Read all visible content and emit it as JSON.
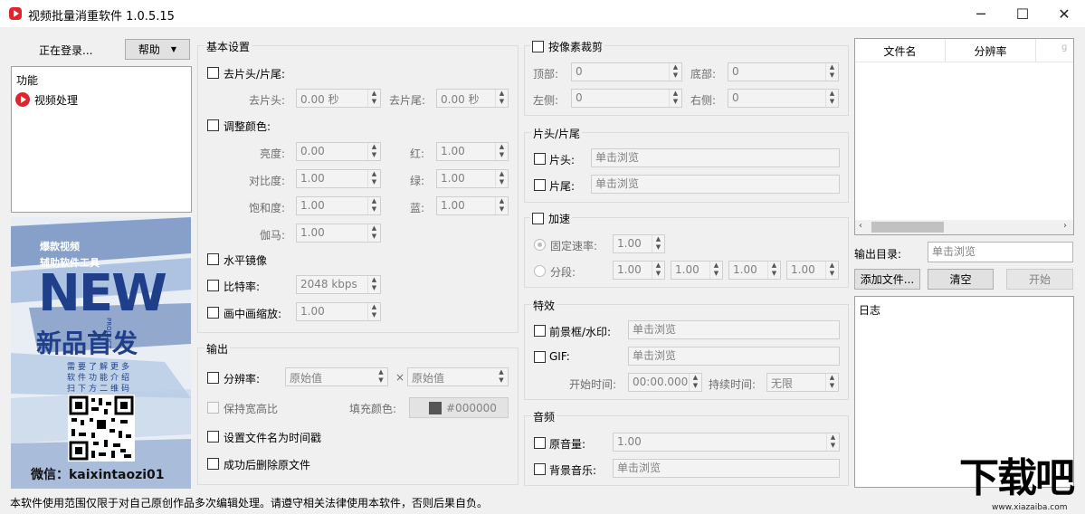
{
  "window": {
    "title": "视频批量消重软件 1.0.5.15",
    "controls": [
      "─",
      "☐",
      "✕"
    ]
  },
  "left": {
    "login_status": "正在登录...",
    "help_button": "帮助",
    "tree_header": "功能",
    "tree_item": "视频处理",
    "ad": {
      "line1": "爆款视频",
      "line2": "辅助软件工具",
      "big": "NEW",
      "big2": "新品首发",
      "product": "PRODUCT",
      "small1": "需要了解更多",
      "small2": "软件功能介绍",
      "small3": "扫下方二维码",
      "wechat": "微信：kaixintaozi01"
    }
  },
  "basic": {
    "title": "基本设置",
    "trim": {
      "label": "去片头/片尾:",
      "head_label": "去片头:",
      "head_value": "0.00 秒",
      "tail_label": "去片尾:",
      "tail_value": "0.00 秒"
    },
    "color": {
      "label": "调整颜色:",
      "brightness_label": "亮度:",
      "brightness": "0.00",
      "contrast_label": "对比度:",
      "contrast": "1.00",
      "saturation_label": "饱和度:",
      "saturation": "1.00",
      "gamma_label": "伽马:",
      "gamma": "1.00",
      "red_label": "红:",
      "red": "1.00",
      "green_label": "绿:",
      "green": "1.00",
      "blue_label": "蓝:",
      "blue": "1.00"
    },
    "mirror_label": "水平镜像",
    "bitrate_label": "比特率:",
    "bitrate_value": "2048 kbps",
    "pip_label": "画中画缩放:",
    "pip_value": "1.00"
  },
  "output": {
    "title": "输出",
    "resolution_label": "分辨率:",
    "res_w": "原始值",
    "res_x": "×",
    "res_h": "原始值",
    "keep_ratio": "保持宽高比",
    "fill_color_label": "填充颜色:",
    "fill_color_value": "#000000",
    "timestamp_name": "设置文件名为时间戳",
    "delete_after": "成功后删除原文件"
  },
  "crop": {
    "label": "按像素裁剪",
    "top_label": "顶部:",
    "top": "0",
    "bottom_label": "底部:",
    "bottom": "0",
    "left_label": "左侧:",
    "left": "0",
    "right_label": "右侧:",
    "right": "0"
  },
  "headtail": {
    "title": "片头/片尾",
    "head_label": "片头:",
    "tail_label": "片尾:",
    "browse": "单击浏览"
  },
  "speed": {
    "label": "加速",
    "fixed_label": "固定速率:",
    "fixed_value": "1.00",
    "segment_label": "分段:",
    "seg_values": [
      "1.00",
      "1.00",
      "1.00",
      "1.00"
    ]
  },
  "effects": {
    "title": "特效",
    "frame_label": "前景框/水印:",
    "gif_label": "GIF:",
    "browse": "单击浏览",
    "start_label": "开始时间:",
    "start_value": "00:00.000",
    "duration_label": "持续时间:",
    "duration_value": "无限"
  },
  "audio": {
    "title": "音频",
    "volume_label": "原音量:",
    "volume_value": "1.00",
    "bgm_label": "背景音乐:",
    "browse": "单击浏览"
  },
  "right": {
    "col_filename": "文件名",
    "col_resolution": "分辨率",
    "col_more": "ɡ",
    "output_dir_label": "输出目录:",
    "output_dir_placeholder": "单击浏览",
    "add_files": "添加文件...",
    "clear": "清空",
    "start": "开始",
    "log_label": "日志"
  },
  "status": "本软件使用范围仅限于对自己原创作品多次编辑处理。请遵守相关法律使用本软件，否则后果自负。",
  "watermark": {
    "text": "下载吧",
    "url": "www.xiazaiba.com"
  },
  "colors": {
    "accent_red": "#e0242c",
    "ad_blue": "#1f3f8a"
  }
}
